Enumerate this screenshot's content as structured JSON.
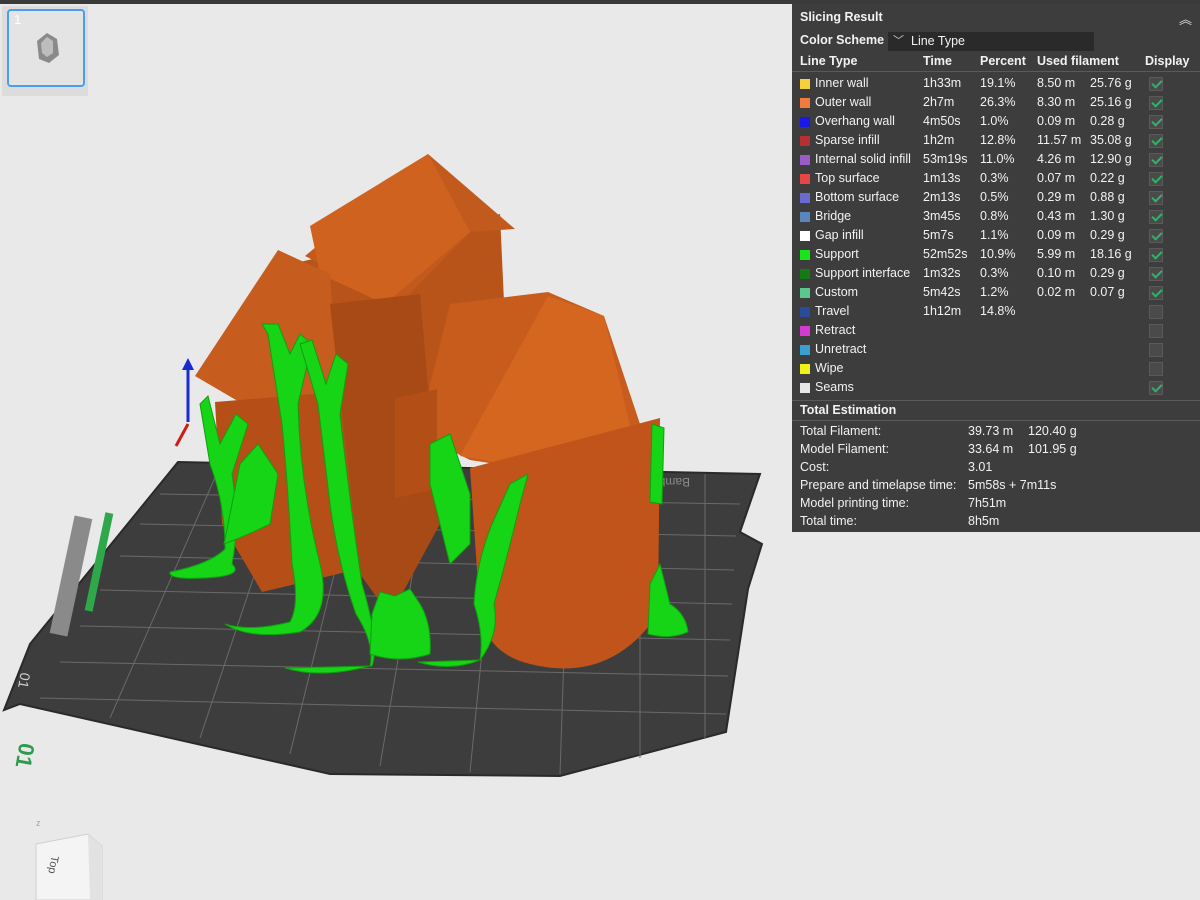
{
  "colors": {
    "model": "#c75a1d",
    "support": "#19d419",
    "plate": "#3b3b3b",
    "panel_bg": "#3d3d3d",
    "accent": "#4a9ef0"
  },
  "plates": [
    {
      "number": "1"
    }
  ],
  "viewport": {
    "plate_logo": "Bambu",
    "plate_number": "01",
    "viewcube_face": "Top",
    "axis_label": "z"
  },
  "panel": {
    "title": "Slicing Result",
    "collapse_icon": "double-chevron-up-icon",
    "color_scheme_label": "Color Scheme",
    "color_scheme_value": "Line Type",
    "headers": {
      "type": "Line Type",
      "time": "Time",
      "percent": "Percent",
      "used": "Used filament",
      "display": "Display"
    },
    "rows": [
      {
        "name": "Inner wall",
        "color": "#f7d13a",
        "time": "1h33m",
        "percent": "19.1%",
        "length": "8.50 m",
        "weight": "25.76 g",
        "display": true
      },
      {
        "name": "Outer wall",
        "color": "#f07b3b",
        "time": "2h7m",
        "percent": "26.3%",
        "length": "8.30 m",
        "weight": "25.16 g",
        "display": true
      },
      {
        "name": "Overhang wall",
        "color": "#1a1ae6",
        "time": "4m50s",
        "percent": "1.0%",
        "length": "0.09 m",
        "weight": "0.28 g",
        "display": true
      },
      {
        "name": "Sparse infill",
        "color": "#b53030",
        "time": "1h2m",
        "percent": "12.8%",
        "length": "11.57 m",
        "weight": "35.08 g",
        "display": true
      },
      {
        "name": "Internal solid infill",
        "color": "#9a5ac8",
        "time": "53m19s",
        "percent": "11.0%",
        "length": "4.26 m",
        "weight": "12.90 g",
        "display": true
      },
      {
        "name": "Top surface",
        "color": "#e64646",
        "time": "1m13s",
        "percent": "0.3%",
        "length": "0.07 m",
        "weight": "0.22 g",
        "display": true
      },
      {
        "name": "Bottom surface",
        "color": "#6a6ad2",
        "time": "2m13s",
        "percent": "0.5%",
        "length": "0.29 m",
        "weight": "0.88 g",
        "display": true
      },
      {
        "name": "Bridge",
        "color": "#5a86be",
        "time": "3m45s",
        "percent": "0.8%",
        "length": "0.43 m",
        "weight": "1.30 g",
        "display": true
      },
      {
        "name": "Gap infill",
        "color": "#ffffff",
        "time": "5m7s",
        "percent": "1.1%",
        "length": "0.09 m",
        "weight": "0.29 g",
        "display": true
      },
      {
        "name": "Support",
        "color": "#19e619",
        "time": "52m52s",
        "percent": "10.9%",
        "length": "5.99 m",
        "weight": "18.16 g",
        "display": true
      },
      {
        "name": "Support interface",
        "color": "#147a14",
        "time": "1m32s",
        "percent": "0.3%",
        "length": "0.10 m",
        "weight": "0.29 g",
        "display": true
      },
      {
        "name": "Custom",
        "color": "#5ac88c",
        "time": "5m42s",
        "percent": "1.2%",
        "length": "0.02 m",
        "weight": "0.07 g",
        "display": true
      },
      {
        "name": "Travel",
        "color": "#2a4a9a",
        "time": "1h12m",
        "percent": "14.8%",
        "length": "",
        "weight": "",
        "display": false
      },
      {
        "name": "Retract",
        "color": "#d23ad2",
        "time": "",
        "percent": "",
        "length": "",
        "weight": "",
        "display": false
      },
      {
        "name": "Unretract",
        "color": "#3aa0d2",
        "time": "",
        "percent": "",
        "length": "",
        "weight": "",
        "display": false
      },
      {
        "name": "Wipe",
        "color": "#f0f01a",
        "time": "",
        "percent": "",
        "length": "",
        "weight": "",
        "display": false
      },
      {
        "name": "Seams",
        "color": "#e6e6e6",
        "time": "",
        "percent": "",
        "length": "",
        "weight": "",
        "display": true
      }
    ],
    "total": {
      "title": "Total Estimation",
      "items": [
        {
          "label": "Total Filament:",
          "value": "39.73 m",
          "value2": "120.40 g"
        },
        {
          "label": "Model Filament:",
          "value": "33.64 m",
          "value2": "101.95 g"
        },
        {
          "label": "Cost:",
          "value": "3.01",
          "value2": ""
        },
        {
          "label": "Prepare and timelapse time:",
          "value": "5m58s + 7m11s",
          "value2": ""
        },
        {
          "label": "Model printing time:",
          "value": "7h51m",
          "value2": ""
        },
        {
          "label": "Total time:",
          "value": "8h5m",
          "value2": ""
        }
      ]
    }
  }
}
